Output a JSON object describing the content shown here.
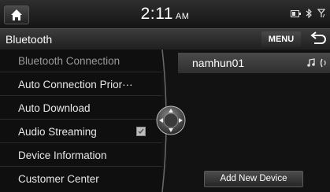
{
  "status": {
    "time": "2:11",
    "ampm": "AM"
  },
  "header": {
    "title": "Bluetooth",
    "menu_label": "MENU"
  },
  "menu": {
    "items": [
      {
        "label": "Bluetooth Connection"
      },
      {
        "label": "Auto Connection Prior···"
      },
      {
        "label": "Auto Download"
      },
      {
        "label": "Audio Streaming",
        "checked": true
      },
      {
        "label": "Device Information"
      },
      {
        "label": "Customer Center"
      }
    ]
  },
  "devices": [
    {
      "name": "namhun01"
    }
  ],
  "add_device_label": "Add New Device",
  "icons": [
    "home-icon",
    "battery-icon",
    "bluetooth-icon",
    "signal-icon",
    "back-icon",
    "music-note-icon",
    "phone-icon",
    "joystick-icon"
  ]
}
